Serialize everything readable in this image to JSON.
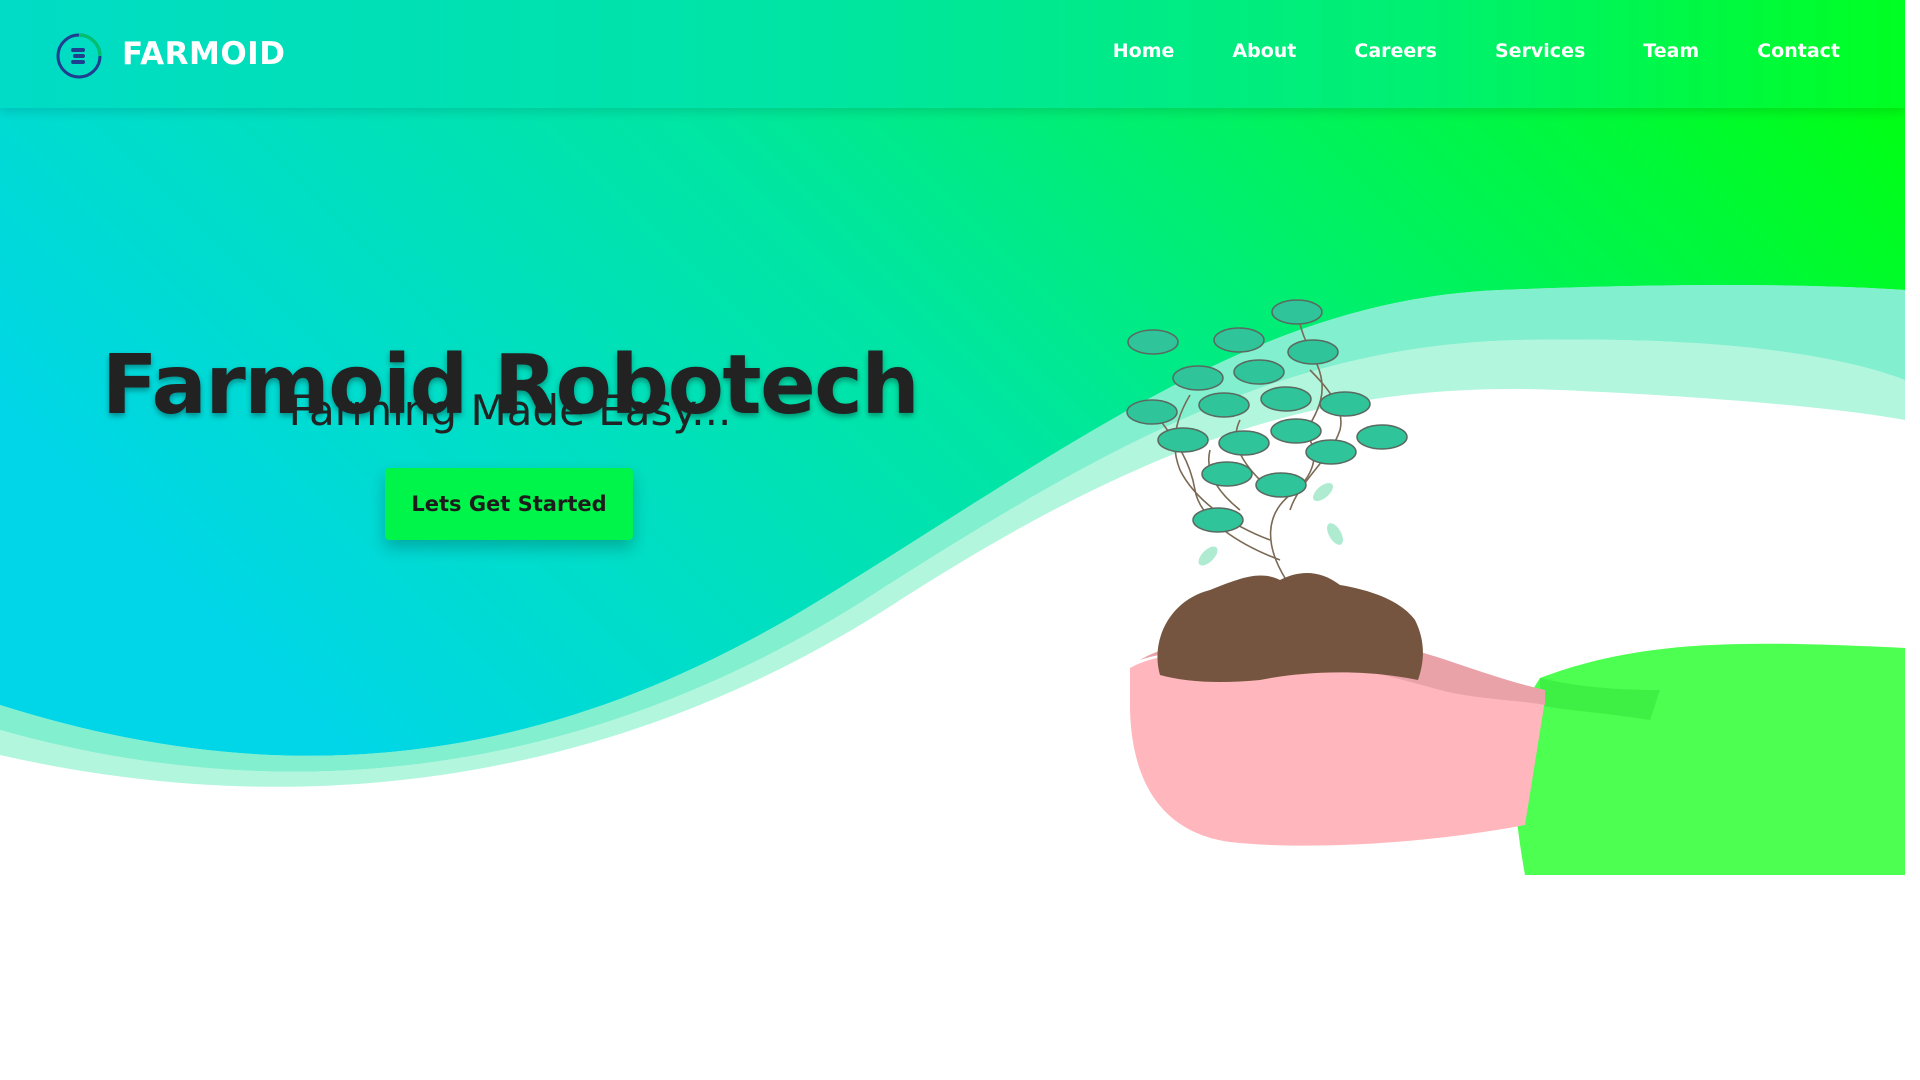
{
  "brand": {
    "name": "FARMOID",
    "logo_icon": "farmoid-circle-logo-icon"
  },
  "nav": {
    "items": [
      {
        "label": "Home"
      },
      {
        "label": "About"
      },
      {
        "label": "Careers"
      },
      {
        "label": "Services"
      },
      {
        "label": "Team"
      },
      {
        "label": "Contact"
      }
    ]
  },
  "hero": {
    "title": "Farmoid Robotech",
    "subtitle": "Farming Made Easy...",
    "cta_label": "Lets Get Started",
    "illustration": "hand-holding-plant-in-soil"
  },
  "colors": {
    "gradient_start": "#00d8e6",
    "gradient_mid": "#00e9a0",
    "gradient_end": "#00ff1a",
    "cta_background": "#00f54a",
    "sleeve": "#4cff50",
    "hand": "#ffb6bc",
    "soil": "#75553f",
    "leaf": "#2fc49a",
    "title_text": "#222222"
  }
}
